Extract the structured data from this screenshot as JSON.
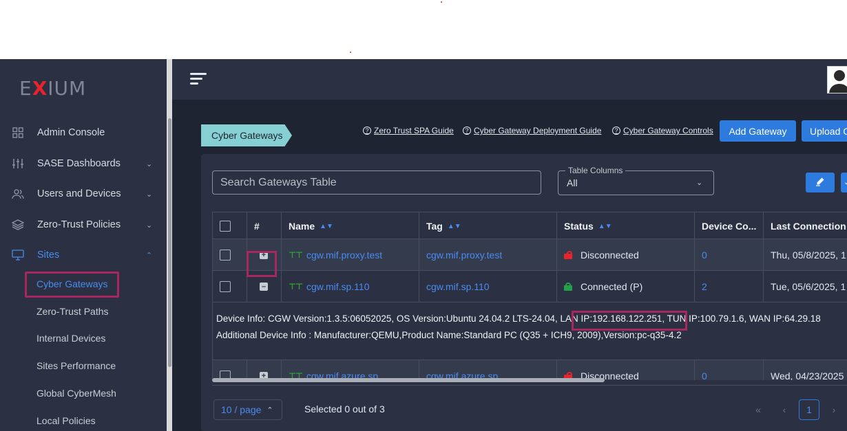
{
  "sidebar": {
    "logo": {
      "pre": "E",
      "x": "X",
      "post": "IUM"
    },
    "items": [
      {
        "label": "Admin Console",
        "icon": "grid-icon",
        "expandable": false
      },
      {
        "label": "SASE Dashboards",
        "icon": "sliders-icon",
        "expandable": true
      },
      {
        "label": "Users and Devices",
        "icon": "users-icon",
        "expandable": true
      },
      {
        "label": "Zero-Trust Policies",
        "icon": "layers-icon",
        "expandable": true
      },
      {
        "label": "Sites",
        "icon": "monitor-icon",
        "expandable": true,
        "active": true
      }
    ],
    "subitems": [
      "Cyber Gateways",
      "Zero-Trust Paths",
      "Internal Devices",
      "Sites Performance",
      "Global CyberMesh",
      "Local Policies"
    ]
  },
  "breadcrumb": "Cyber Gateways",
  "guides": [
    "Zero Trust SPA Guide",
    "Cyber Gateway Deployment Guide",
    "Cyber Gateway Controls"
  ],
  "buttons": {
    "add": "Add Gateway",
    "upload": "Upload G"
  },
  "search": {
    "placeholder": "Search Gateways Table"
  },
  "columns_select": {
    "legend": "Table Columns",
    "value": "All"
  },
  "table": {
    "headers": [
      "#",
      "Name",
      "Tag",
      "Status",
      "Device Co...",
      "Last Connection U"
    ],
    "rows": [
      {
        "name": "cgw.mif.proxy.test",
        "tag": "cgw.mif.proxy.test",
        "status": "Disconnected",
        "status_color": "#e8242b",
        "devices": "0",
        "last": "Thu, 05/8/2025, 1",
        "expanded": false
      },
      {
        "name": "cgw.mif.sp.110",
        "tag": "cgw.mif.sp.110",
        "status": "Connected (P)",
        "status_color": "#23a04a",
        "devices": "2",
        "last": "Tue, 05/6/2025, 1",
        "expanded": true
      },
      {
        "name": "cgw.mif.azure.sp",
        "tag": "cgw.mif.azure.sp",
        "status": "Disconnected",
        "status_color": "#e8242b",
        "devices": "0",
        "last": "Wed, 04/23/2025",
        "expanded": false
      }
    ],
    "detail": {
      "line1_pre": "Device Info: CGW Version:1.3.5:06052025, OS Version:Ubuntu 24.04.2 LTS-24.04, ",
      "line1_lan": "LAN IP:192.168.122.251,",
      "line1_post": " TUN IP:100.79.1.6, WAN IP:64.29.18",
      "line2": "Additional Device Info : Manufacturer:QEMU,Product Name:Standard PC (Q35 + ICH9, 2009),Version:pc-q35-4.2"
    }
  },
  "pagination": {
    "per_page": "10 / page",
    "selected": "Selected 0 out of 3",
    "current": "1"
  },
  "colors": {
    "accent": "#2e7be0",
    "sidebar_bg": "#2b3142",
    "content_bg": "#1f2433",
    "highlight": "#a8275f",
    "crumb": "#86d0d3"
  }
}
